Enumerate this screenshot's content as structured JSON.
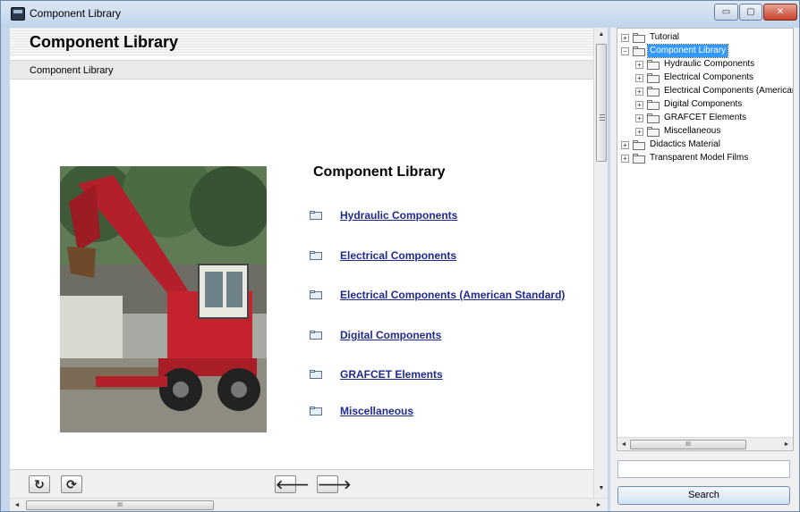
{
  "window": {
    "title": "Component Library",
    "controls": {
      "minimize": "▭",
      "maximize": "▢",
      "close": "✕"
    }
  },
  "content": {
    "page_heading": "Component Library",
    "breadcrumb": "Component Library",
    "section_heading": "Component Library",
    "links": [
      {
        "label": "Hydraulic Components"
      },
      {
        "label": "Electrical Components"
      },
      {
        "label": "Electrical Components (American Standard)"
      },
      {
        "label": "Digital Components"
      },
      {
        "label": "GRAFCET Elements"
      },
      {
        "label": "Miscellaneous"
      }
    ]
  },
  "nav": {
    "reload": "↻",
    "refresh": "⟳",
    "back": "🡐",
    "forward": "🡒"
  },
  "scrollbars": {
    "up": "▲",
    "down": "▼",
    "left": "◄",
    "right": "►",
    "grip": "III"
  },
  "tree": {
    "items": [
      {
        "label": "Tutorial",
        "expander": "+"
      },
      {
        "label": "Component Library",
        "expander": "−",
        "selected": true
      },
      {
        "label": "Hydraulic Components",
        "expander": "+"
      },
      {
        "label": "Electrical Components",
        "expander": "+"
      },
      {
        "label": "Electrical Components (American",
        "expander": "+"
      },
      {
        "label": "Digital Components",
        "expander": "+"
      },
      {
        "label": "GRAFCET Elements",
        "expander": "+"
      },
      {
        "label": "Miscellaneous",
        "expander": "+"
      },
      {
        "label": "Didactics Material",
        "expander": "+"
      },
      {
        "label": "Transparent Model Films",
        "expander": "+"
      }
    ]
  },
  "search": {
    "value": "",
    "placeholder": "",
    "button_label": "Search"
  },
  "colors": {
    "link": "#1f2a8f",
    "selection": "#3399ff",
    "title_bar": "#c5d7ec"
  }
}
